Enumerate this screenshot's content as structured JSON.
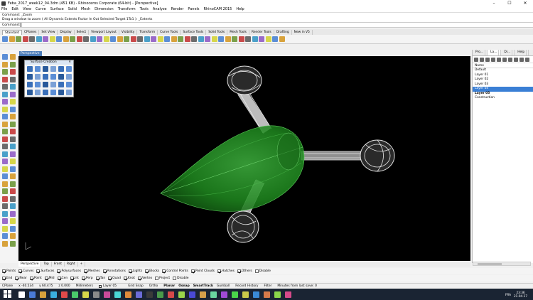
{
  "window": {
    "title": "Feba_2017_week12_04.3dm (451 KB) - Rhinoceros Corporate (64-bit) - [Perspective]",
    "minimize": "–",
    "maximize": "☐",
    "close": "✕"
  },
  "menu": [
    "File",
    "Edit",
    "View",
    "Curve",
    "Surface",
    "Solid",
    "Mesh",
    "Dimension",
    "Transform",
    "Tools",
    "Analyze",
    "Render",
    "Panels",
    "RhinoCAM 2015",
    "Help"
  ],
  "command_history": [
    "Command: _Zoom",
    "Drag a window to zoom ( All  Dynamic  Extents  Factor  In  Out  Selected  Target  1To1 ): _Extents"
  ],
  "command_prompt": "Command:",
  "toolbar_tabs": [
    {
      "label": "Standard",
      "active": true
    },
    {
      "label": "CPlanes"
    },
    {
      "label": "Set View"
    },
    {
      "label": "Display"
    },
    {
      "label": "Select"
    },
    {
      "label": "Viewport Layout"
    },
    {
      "label": "Visibility"
    },
    {
      "label": "Transform"
    },
    {
      "label": "Curve Tools"
    },
    {
      "label": "Surface Tools"
    },
    {
      "label": "Solid Tools"
    },
    {
      "label": "Mesh Tools"
    },
    {
      "label": "Render Tools"
    },
    {
      "label": "Drafting"
    },
    {
      "label": "New in V5"
    }
  ],
  "viewport": {
    "title": "Perspective",
    "dropdown": "▾",
    "background": "#000000"
  },
  "floating_panel": {
    "title": "Surface Creation",
    "close": "✕"
  },
  "right_panel": {
    "tabs": [
      "Pro...",
      "La...",
      "Di...",
      "Help"
    ],
    "column_header": "Name",
    "layers": [
      {
        "name": "Default"
      },
      {
        "name": "Layer 01"
      },
      {
        "name": "Layer 02"
      },
      {
        "name": "Layer 03"
      },
      {
        "name": "Layer 04",
        "selected": true
      },
      {
        "name": "Layer 05",
        "current": true
      },
      {
        "name": "Construction"
      }
    ]
  },
  "viewport_tabs": [
    "Perspective",
    "Top",
    "Front",
    "Right",
    "+"
  ],
  "filter_row": [
    {
      "label": "Points",
      "checked": true
    },
    {
      "label": "Curves",
      "checked": true
    },
    {
      "label": "Surfaces",
      "checked": true
    },
    {
      "label": "Polysurfaces",
      "checked": true
    },
    {
      "label": "Meshes",
      "checked": true
    },
    {
      "label": "Annotations",
      "checked": true
    },
    {
      "label": "Lights",
      "checked": true
    },
    {
      "label": "Blocks",
      "checked": true
    },
    {
      "label": "Control Points",
      "checked": true
    },
    {
      "label": "Point Clouds",
      "checked": true
    },
    {
      "label": "Hatches",
      "checked": true
    },
    {
      "label": "Others",
      "checked": true
    },
    {
      "label": "Disable",
      "checked": false
    }
  ],
  "osnap_row": [
    {
      "label": "End",
      "checked": true
    },
    {
      "label": "Near",
      "checked": true
    },
    {
      "label": "Point",
      "checked": true
    },
    {
      "label": "Mid",
      "checked": true
    },
    {
      "label": "Cen",
      "checked": true
    },
    {
      "label": "Int",
      "checked": true
    },
    {
      "label": "Perp",
      "checked": true
    },
    {
      "label": "Tan",
      "checked": true
    },
    {
      "label": "Quad",
      "checked": true
    },
    {
      "label": "Knot",
      "checked": true
    },
    {
      "label": "Vertex",
      "checked": true
    },
    {
      "label": "Project",
      "checked": false
    },
    {
      "label": "Disable",
      "checked": false
    }
  ],
  "status": {
    "cplane": "CPlane",
    "x": "x -40.534",
    "y": "y 60.475",
    "z": "z 0.000",
    "units": "Millimeters",
    "layer": "Layer 05",
    "panes": [
      "Grid Snap",
      "Ortho",
      "Planar",
      "Osnap",
      "SmartTrack",
      "Gumball",
      "Record History",
      "Filter"
    ],
    "message": "Minutes from last save: 0"
  },
  "taskbar": {
    "lang": "FRA",
    "time": "23:36",
    "date": "21-04-17"
  },
  "colors": {
    "accent": "#3a7fd5",
    "model_green": "#1f8a1f",
    "taskbar": "#1a2433"
  },
  "icons": [
    "windows-start-icon",
    "search-icon",
    "rhino-app-icon",
    "gear-icon",
    "close-icon"
  ]
}
